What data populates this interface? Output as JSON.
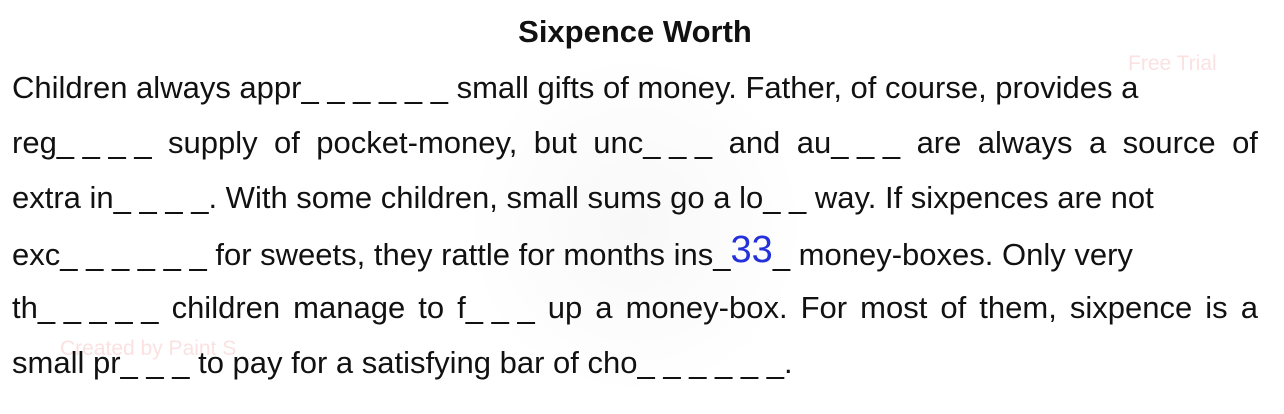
{
  "title": "Sixpence Worth",
  "watermarks": {
    "trial": "Free Trial",
    "created": "Created by Paint S"
  },
  "lines": {
    "l1": "Children always appr_ _ _ _ _ _ small gifts of money. Father, of course, provides a",
    "l2": [
      "reg_ _ _ _",
      "supply",
      "of",
      "pocket-money,",
      "but",
      "unc_ _ _",
      "and",
      "au_ _ _",
      "are",
      "always",
      "a",
      "source",
      "of"
    ],
    "l3": "extra in_ _ _ _. With some children, small sums go a lo_ _ way. If sixpences are not",
    "l4": {
      "before": "exc_ _ _ _ _ _ for sweets, they rattle for months ins_",
      "answer": "33",
      "after": "_ money-boxes. Only very"
    },
    "l5": [
      "th_ _ _ _ _",
      "children",
      "manage",
      "to",
      "f_ _ _",
      "up",
      "a",
      "money-box.",
      "For",
      "most",
      "of",
      "them,",
      "sixpence",
      "is",
      "a"
    ],
    "l6": "small pr_ _ _ to pay for a satisfying bar of cho_ _ _ _ _ _."
  },
  "colors": {
    "text": "#111111",
    "answer": "#2430d9",
    "watermark": "#eb7878"
  }
}
